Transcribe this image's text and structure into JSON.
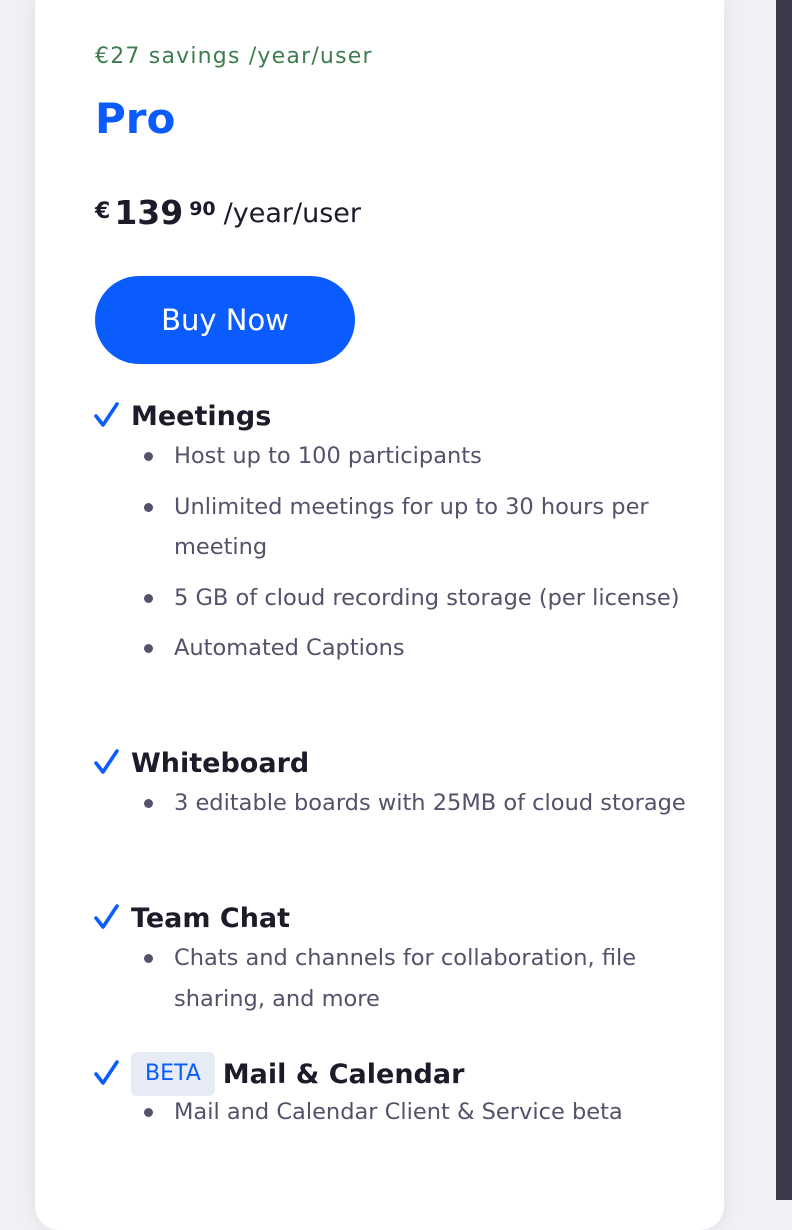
{
  "plan": {
    "savings": "€27 savings /year/user",
    "name": "Pro",
    "price": {
      "currency": "€",
      "amount": "139",
      "cents": "90",
      "period": "/year/user"
    },
    "buy_label": "Buy Now"
  },
  "sections": [
    {
      "title": "Meetings",
      "items": [
        "Host up to 100 participants",
        "Unlimited meetings for up to 30 hours per meeting",
        "5 GB of cloud recording storage (per license)",
        "Automated Captions"
      ]
    },
    {
      "title": "Whiteboard",
      "items": [
        "3 editable boards with 25MB of cloud storage"
      ]
    },
    {
      "title": "Team Chat",
      "items": [
        "Chats and channels for collaboration, file sharing, and more"
      ]
    },
    {
      "title": "Mail & Calendar",
      "badge": "BETA",
      "items": [
        "Mail and Calendar Client & Service beta"
      ]
    }
  ],
  "colors": {
    "accent": "#0b5cff",
    "savings": "#3e7d4f",
    "text_dark": "#1b1b2a",
    "text_muted": "#52526a"
  },
  "icons": {
    "section_marker": "checkmark-icon",
    "list_marker": "bullet-dot"
  }
}
